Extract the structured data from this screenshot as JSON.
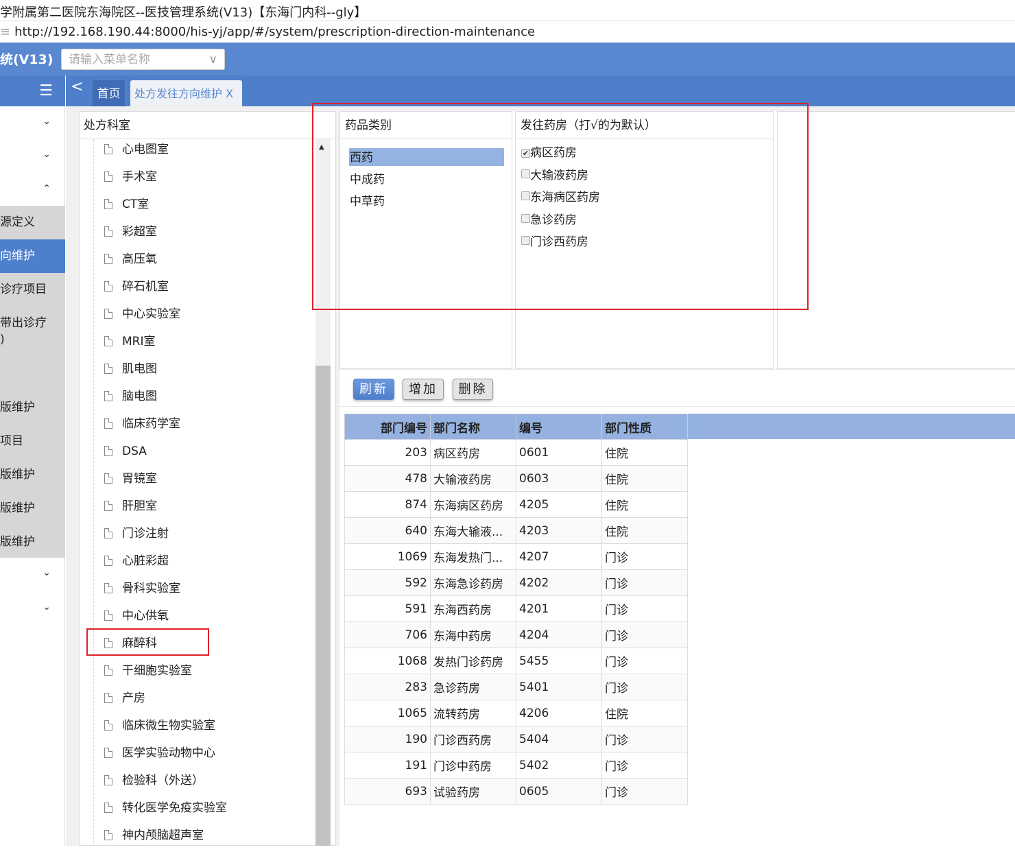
{
  "window": {
    "title": "学附属第二医院东海院区--医技管理系统(V13)【东海门内科--gly】",
    "url_prefix": "≡",
    "url": "http://192.168.190.44:8000/his-yj/app/#/system/prescription-direction-maintenance"
  },
  "header": {
    "app_name": "统(V13)",
    "menu_search_placeholder": "请输入菜单名称",
    "chevron": "∨"
  },
  "tabs": {
    "toggle_icon": "☰",
    "back_icon": "<",
    "home": "首页",
    "current": "处方发往方向维护 X"
  },
  "sidebar": {
    "items": [
      {
        "label": "源定义"
      },
      {
        "label": "向维护",
        "active": true
      },
      {
        "label": "诊疗项目"
      },
      {
        "label": "带出诊疗\n)"
      },
      {
        "label": "版维护"
      },
      {
        "label": "项目"
      },
      {
        "label": "版维护"
      },
      {
        "label": "版维护"
      },
      {
        "label": "版维护"
      }
    ]
  },
  "tree": {
    "title": "处方科室",
    "items": [
      "心电图室",
      "手术室",
      "CT室",
      "彩超室",
      "高压氧",
      "碎石机室",
      "中心实验室",
      "MRI室",
      "肌电图",
      "脑电图",
      "临床药学室",
      "DSA",
      "胃镜室",
      "肝胆室",
      "门诊注射",
      "心脏彩超",
      "骨科实验室",
      "中心供氧",
      "麻醉科",
      "干细胞实验室",
      "产房",
      "临床微生物实验室",
      "医学实验动物中心",
      "检验科（外送）",
      "转化医学免疫实验室",
      "神内颅脑超声室"
    ],
    "highlighted": "麻醉科"
  },
  "categories": {
    "title": "药品类别",
    "items": [
      "西药",
      "中成药",
      "中草药"
    ],
    "selected": "西药"
  },
  "pharmacies": {
    "title": "发往药房（打√的为默认）",
    "items": [
      {
        "label": "病区药房",
        "checked": true
      },
      {
        "label": "大输液药房",
        "checked": false
      },
      {
        "label": "东海病区药房",
        "checked": false
      },
      {
        "label": "急诊药房",
        "checked": false
      },
      {
        "label": "门诊西药房",
        "checked": false
      }
    ]
  },
  "toolbar": {
    "refresh": "刷新",
    "add": "增加",
    "delete": "删除"
  },
  "grid": {
    "columns": [
      "部门编号",
      "部门名称",
      "编号",
      "部门性质"
    ],
    "rows": [
      [
        "203",
        "病区药房",
        "0601",
        "住院"
      ],
      [
        "478",
        "大输液药房",
        "0603",
        "住院"
      ],
      [
        "874",
        "东海病区药房",
        "4205",
        "住院"
      ],
      [
        "640",
        "东海大输液...",
        "4203",
        "住院"
      ],
      [
        "1069",
        "东海发热门...",
        "4207",
        "门诊"
      ],
      [
        "592",
        "东海急诊药房",
        "4202",
        "门诊"
      ],
      [
        "591",
        "东海西药房",
        "4201",
        "门诊"
      ],
      [
        "706",
        "东海中药房",
        "4204",
        "门诊"
      ],
      [
        "1068",
        "发热门诊药房",
        "5455",
        "门诊"
      ],
      [
        "283",
        "急诊药房",
        "5401",
        "门诊"
      ],
      [
        "1065",
        "流转药房",
        "4206",
        "住院"
      ],
      [
        "190",
        "门诊西药房",
        "5404",
        "门诊"
      ],
      [
        "191",
        "门诊中药房",
        "5402",
        "门诊"
      ],
      [
        "693",
        "试验药房",
        "0605",
        "门诊"
      ]
    ]
  },
  "colors": {
    "header": "#5a88d0",
    "selection": "#95b3e0",
    "annotation": "#e0202a"
  }
}
